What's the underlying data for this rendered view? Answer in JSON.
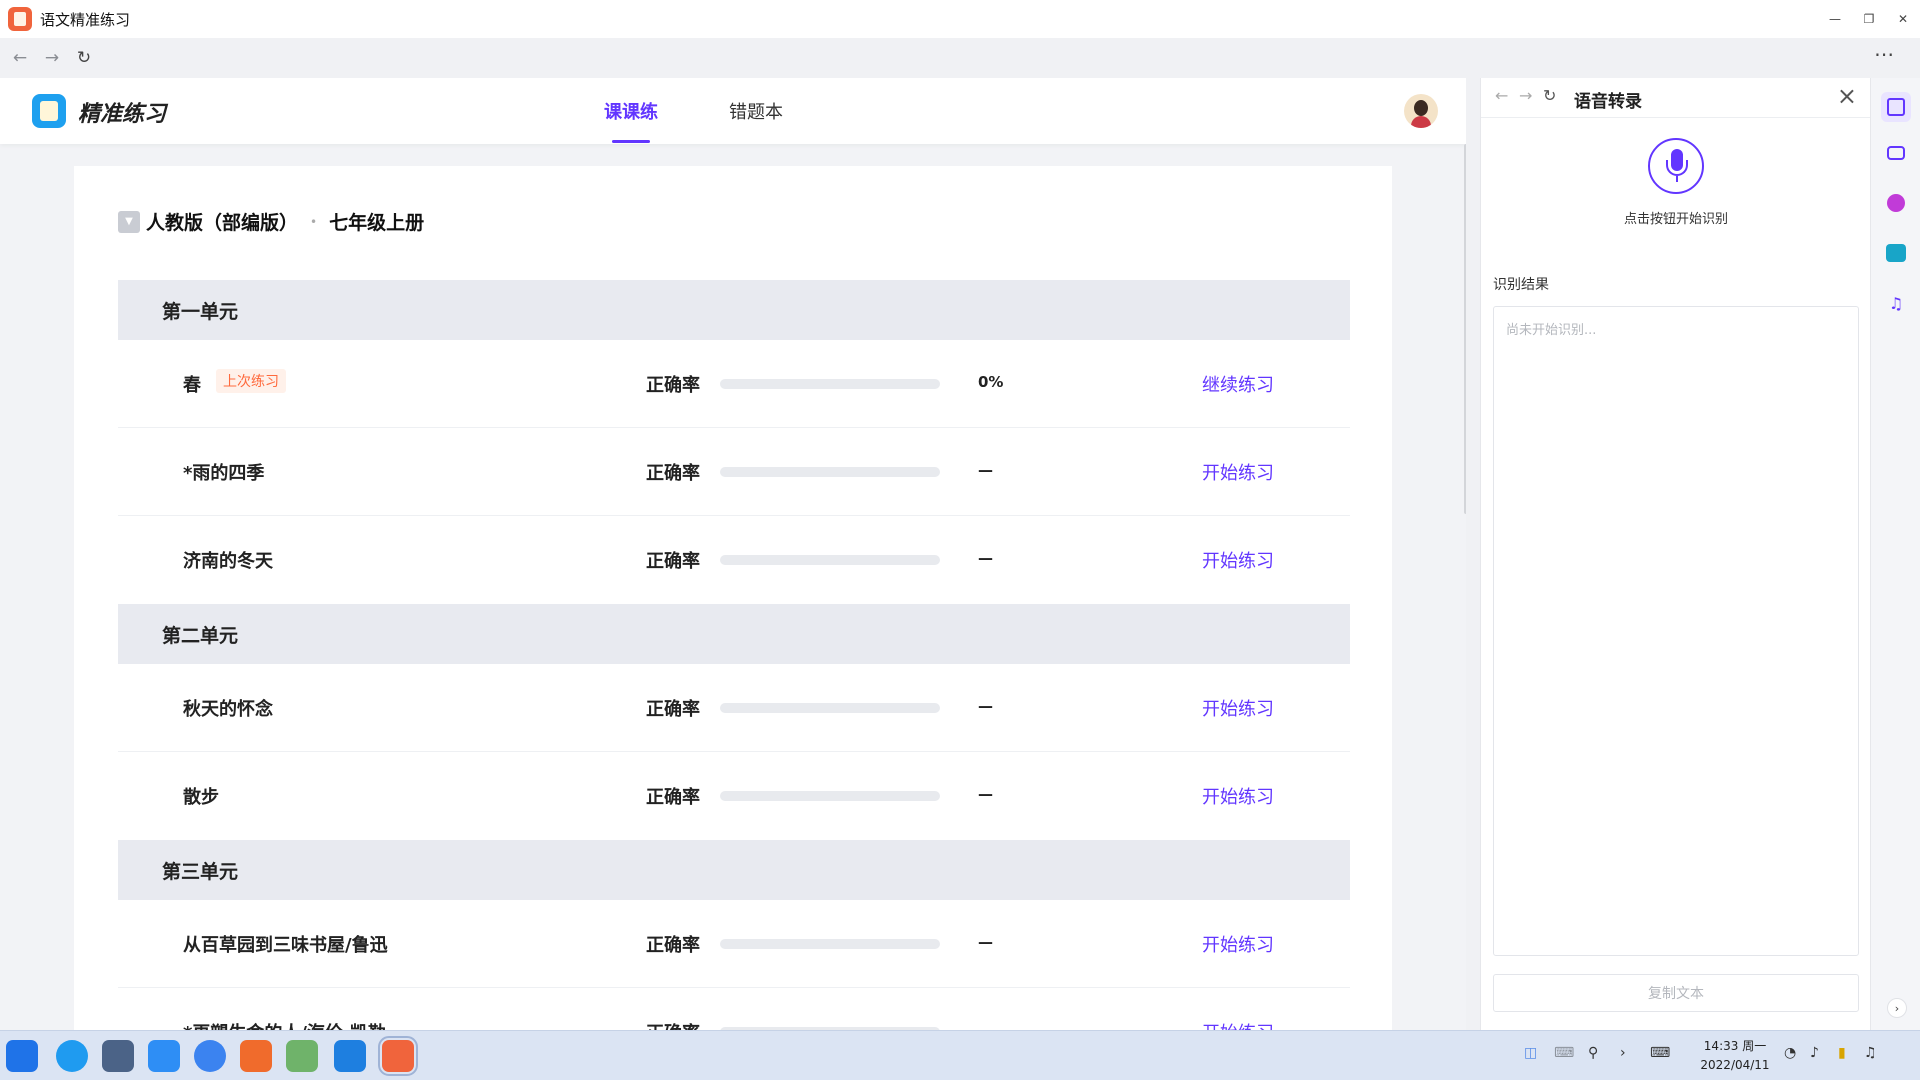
{
  "window": {
    "title": "语文精准练习"
  },
  "app": {
    "brand": "精准练习",
    "tabs": [
      {
        "label": "课课练"
      },
      {
        "label": "错题本"
      }
    ],
    "book": {
      "edition": "人教版（部编版）",
      "grade": "七年级上册"
    }
  },
  "units": [
    {
      "name": "第一单元"
    },
    {
      "name": "第二单元"
    },
    {
      "name": "第三单元"
    }
  ],
  "lessons": [
    {
      "name": "春",
      "badge": "上次练习",
      "acc_label": "正确率",
      "accuracy": "0%",
      "progress": 0,
      "action": "继续练习"
    },
    {
      "name": "*雨的四季",
      "acc_label": "正确率",
      "accuracy": "—",
      "progress": 0,
      "action": "开始练习"
    },
    {
      "name": "济南的冬天",
      "acc_label": "正确率",
      "accuracy": "—",
      "progress": 0,
      "action": "开始练习"
    },
    {
      "name": "秋天的怀念",
      "acc_label": "正确率",
      "accuracy": "—",
      "progress": 0,
      "action": "开始练习"
    },
    {
      "name": "散步",
      "acc_label": "正确率",
      "accuracy": "—",
      "progress": 0,
      "action": "开始练习"
    },
    {
      "name": "从百草园到三味书屋/鲁迅",
      "acc_label": "正确率",
      "accuracy": "—",
      "progress": 0,
      "action": "开始练习"
    },
    {
      "name": "*再塑生命的人/海伦·凯勒",
      "acc_label": "正确率",
      "accuracy": "—",
      "progress": 0,
      "action": "开始练习"
    }
  ],
  "panel": {
    "title": "语音转录",
    "mic_hint": "点击按钮开始识别",
    "result_label": "识别结果",
    "result_placeholder": "尚未开始识别...",
    "copy_label": "复制文本"
  },
  "taskbar": {
    "time": "14:33 周一",
    "date": "2022/04/11"
  },
  "colors": {
    "accent": "#6236ff",
    "badge": "#ff6a3d",
    "unit_bg": "#e8eaf0"
  }
}
